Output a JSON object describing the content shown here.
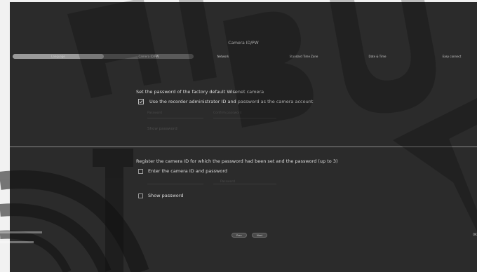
{
  "window": {
    "title": "Camera ID/PW"
  },
  "steps": [
    {
      "label": "Language",
      "active": true
    },
    {
      "label": "Camera ID/PW",
      "active": true
    },
    {
      "label": "Network",
      "active": false
    },
    {
      "label": "Standard Time Zone",
      "active": false
    },
    {
      "label": "Date & Time",
      "active": false
    },
    {
      "label": "Easy connect",
      "active": false
    }
  ],
  "section1": {
    "title": "Set the password of the factory default Wisenet camera",
    "use_admin_label": "Use the recorder administrator ID and password as the camera account",
    "use_admin_checked": true,
    "password_label": "Password",
    "password_confirm_label": "Confirm password",
    "show_password_label": "Show password"
  },
  "section2": {
    "title": "Register the camera ID for which the password had been set and the password (up to 3)",
    "enter_id_label": "Enter the camera ID and password",
    "enter_id_checked": false,
    "password_label": "Password",
    "show_password_label": "Show password",
    "show_password_checked": false
  },
  "footer": {
    "prev_label": "Prev",
    "next_label": "Next",
    "ok_label": "OK"
  },
  "colors": {
    "background": "#2b2b2b",
    "text": "#dedede",
    "step_active": "#9a9a9a",
    "step_inactive": "#5a5a5a"
  }
}
